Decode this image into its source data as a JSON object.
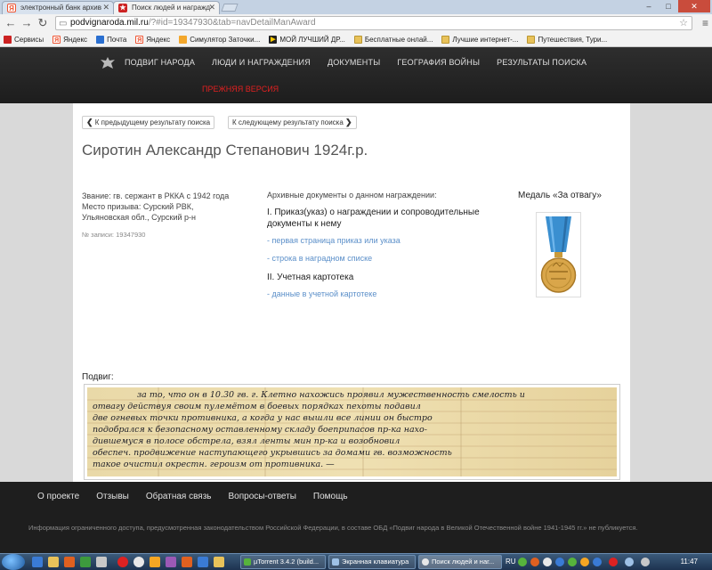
{
  "browser": {
    "tabs": [
      {
        "label": "электронный банк архив",
        "favicon": "yandex-favicon"
      },
      {
        "label": "Поиск людей и награжд",
        "favicon": "podvig-favicon",
        "active": true
      }
    ],
    "url_host": "podvignaroda.mil.ru",
    "url_rest": "/?#id=19347930&tab=navDetailManAward",
    "bookmarks": [
      {
        "label": "Сервисы",
        "icon": "apps-grid-icon"
      },
      {
        "label": "Яндекс",
        "icon": "yandex-icon"
      },
      {
        "label": "Почта",
        "icon": "mail-icon"
      },
      {
        "label": "Яндекс",
        "icon": "yandex-icon"
      },
      {
        "label": "Симулятор Заточки...",
        "icon": "simulator-icon"
      },
      {
        "label": "МОЙ ЛУЧШИЙ ДР...",
        "icon": "music-icon"
      },
      {
        "label": "Бесплатные онлай...",
        "icon": "folder-icon"
      },
      {
        "label": "Лучшие интернет-...",
        "icon": "folder-icon"
      },
      {
        "label": "Путешествия, Тури...",
        "icon": "folder-icon"
      }
    ]
  },
  "site": {
    "nav": [
      "ПОДВИГ НАРОДА",
      "ЛЮДИ И НАГРАЖДЕНИЯ",
      "ДОКУМЕНТЫ",
      "ГЕОГРАФИЯ ВОЙНЫ",
      "РЕЗУЛЬТАТЫ ПОИСКА"
    ],
    "old_version": "ПРЕЖНЯЯ ВЕРСИЯ",
    "prev_result": "К предыдущему результату поиска",
    "next_result": "К следующему результату поиска",
    "person_name": "Сиротин Александр Степанович 1924г.р.",
    "details": "Звание: гв. сержант в РККА с 1942 года Место призыва: Сурский РВК, Ульяновская обл., Сурский р-н",
    "record_number": "№ записи: 19347930",
    "archive_heading": "Архивные документы о данном награждении:",
    "section1": "I. Приказ(указ) о награждении и сопроводительные документы к нему",
    "link1": "- первая страница приказ или указа",
    "link2": "- строка в наградном списке",
    "section2": "II. Учетная картотека",
    "link3": "- данные в учетной картотеке",
    "medal_title": "Медаль «За отвагу»",
    "feat_label": "Подвиг:",
    "handwritten_text": [
      "за то, что он в 10.30 гв. г. Клетно нахожись проявил мужественность смелость и",
      "отвагу действуя своим пулемётом в боевых порядках пехоты подавил",
      "две огневых точки противника, а когда у нас вышли все линии он быстро",
      "подобрался к безопасному оставленному складу боеприпасов пр-ка нахо-",
      "дившемуся в полосе обстрела, взял ленты мин пр-ка и возобновил",
      "обеспеч. продвижение наступающего укрывшись за домами гв. возможность",
      "такое очистил окрестн. героизм от противника. —"
    ],
    "footer_links": [
      "О проекте",
      "Отзывы",
      "Обратная связь",
      "Вопросы-ответы",
      "Помощь"
    ],
    "footer_legal": "Информация ограниченного доступа, предусмотренная законодательством Российской Федерации, в составе ОБД «Подвиг народа в Великой Отечественной войне 1941-1945 гг.» не публикуется."
  },
  "taskbar": {
    "tasks": [
      "µTorrent 3.4.2  (build...",
      "Экранная клавиатура",
      "Поиск людей и наг..."
    ],
    "language": "RU",
    "time": "11:47"
  },
  "colors": {
    "accent_red": "#e02020",
    "link_blue": "#5b8fc9",
    "header_dark": "#222222"
  }
}
